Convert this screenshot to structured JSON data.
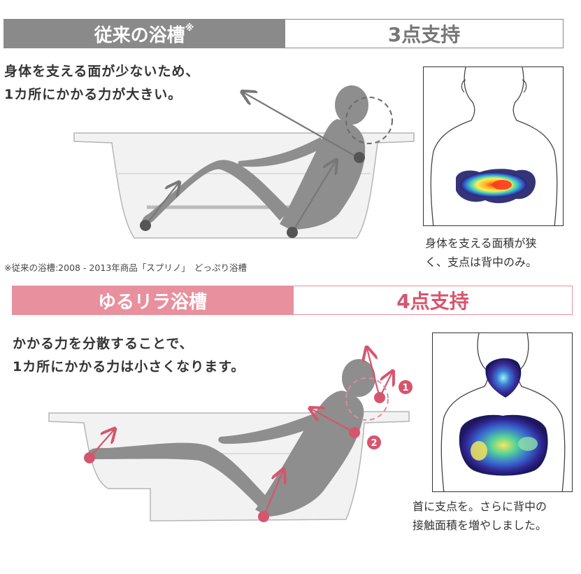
{
  "colors": {
    "gray_header": "#8a8a8a",
    "pink_header": "#e8909e",
    "pink_accent": "#d6556e",
    "figure_gray": "#8e8e8e",
    "arrow_gray": "#777777",
    "text": "#333333"
  },
  "conventional": {
    "label": "従来の浴槽",
    "label_mark": "※",
    "support": "3点支持",
    "description": [
      "身体を支える面が少ないため、",
      "1カ所にかかる力が大きい。"
    ],
    "caption": [
      "身体を支える面積が狭",
      "く、支点は背中のみ。"
    ],
    "footnote": "※従来の浴槽:2008 - 2013年商品「スプリノ」　どっぷり浴槽"
  },
  "yururira": {
    "label": "ゆるリラ浴槽",
    "support": "4点支持",
    "description": [
      "かかる力を分散することで、",
      "1カ所にかかる力は小さくなります。"
    ],
    "caption": [
      "首に支点を。さらに背中の",
      "接触面積を増やしました。"
    ],
    "markers": [
      "1",
      "2"
    ]
  }
}
